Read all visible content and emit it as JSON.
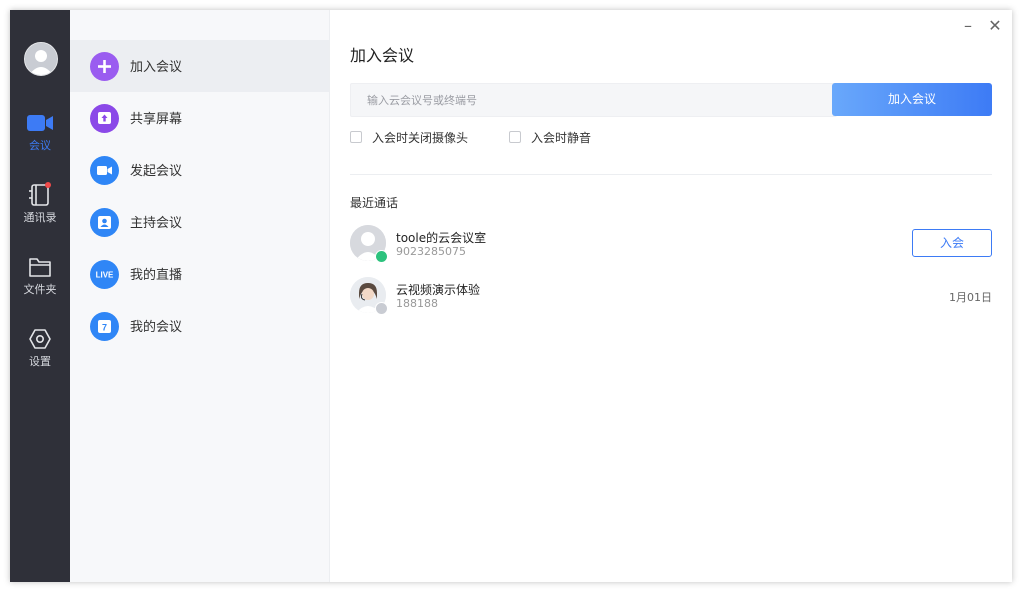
{
  "rail": {
    "items": [
      {
        "label": "会议",
        "icon": "video-camera-icon",
        "active": true
      },
      {
        "label": "通讯录",
        "icon": "contacts-book-icon",
        "badge": true
      },
      {
        "label": "文件夹",
        "icon": "folder-icon"
      },
      {
        "label": "设置",
        "icon": "settings-hexagon-icon"
      }
    ]
  },
  "menu": {
    "items": [
      {
        "label": "加入会议",
        "icon": "plus-icon",
        "color": "#9a5cf0",
        "active": true
      },
      {
        "label": "共享屏幕",
        "icon": "share-screen-icon",
        "color": "#8b49e8"
      },
      {
        "label": "发起会议",
        "icon": "video-icon",
        "color": "#2f86f6"
      },
      {
        "label": "主持会议",
        "icon": "host-icon",
        "color": "#2f86f6"
      },
      {
        "label": "我的直播",
        "icon": "live-icon",
        "icon_text": "LIVE",
        "color": "#2f86f6"
      },
      {
        "label": "我的会议",
        "icon": "calendar-icon",
        "icon_text": "7",
        "color": "#2f86f6"
      }
    ]
  },
  "main": {
    "title": "加入会议",
    "input_placeholder": "输入云会议号或终端号",
    "join_button": "加入会议",
    "options": [
      {
        "label": "入会时关闭摄像头",
        "checked": false
      },
      {
        "label": "入会时静音",
        "checked": false
      }
    ],
    "recent_title": "最近通话",
    "recent_calls": [
      {
        "name": "toole的云会议室",
        "id": "9023285075",
        "action": "入会",
        "badge_color": "#2cc27d"
      },
      {
        "name": "云视频演示体验",
        "id": "188188",
        "date": "1月01日",
        "badge_color": "#c9ccd3"
      }
    ]
  },
  "window_controls": {
    "minimize": "–",
    "close": "✕"
  },
  "colors": {
    "accent": "#3d7bf5",
    "rail_bg": "#2f3039",
    "menu_bg": "#f7f8fa"
  }
}
